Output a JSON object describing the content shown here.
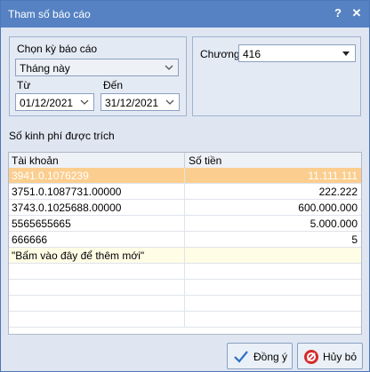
{
  "window": {
    "title": "Tham số báo cáo",
    "help_label": "?",
    "close_label": "✕"
  },
  "report_period": {
    "label": "Chọn kỳ báo cáo",
    "selected": "Tháng này",
    "from_label": "Từ",
    "from_value": "01/12/2021",
    "to_label": "Đến",
    "to_value": "31/12/2021"
  },
  "chapter": {
    "label": "Chương",
    "value": "416"
  },
  "funding": {
    "title": "Số kinh phí được trích",
    "columns": [
      "Tài khoản",
      "Số tiền"
    ],
    "rows": [
      {
        "account": "3941.0.1076239",
        "amount": "11.111.111"
      },
      {
        "account": "3751.0.1087731.00000",
        "amount": "222.222"
      },
      {
        "account": "3743.0.1025688.00000",
        "amount": "600.000.000"
      },
      {
        "account": "5565655665",
        "amount": "5.000.000"
      },
      {
        "account": "666666",
        "amount": "5"
      }
    ],
    "add_row_text": "\"Bấm vào đây để thêm mới\""
  },
  "buttons": {
    "ok": "Đồng ý",
    "cancel": "Hủy bỏ"
  },
  "colors": {
    "titlebar": "#5682c3",
    "selected_row": "#fbce8f",
    "add_row": "#fffde6"
  }
}
